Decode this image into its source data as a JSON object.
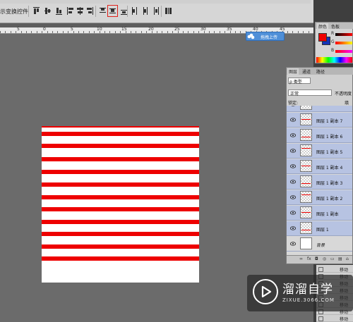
{
  "options_bar": {
    "label": "示变换控件",
    "tools": [
      {
        "name": "align-top-edges-icon"
      },
      {
        "name": "align-vertical-centers-icon"
      },
      {
        "name": "align-bottom-edges-icon"
      },
      {
        "name": "align-left-edges-icon"
      },
      {
        "name": "align-horizontal-centers-icon"
      },
      {
        "name": "align-right-edges-icon"
      },
      {
        "name": "distribute-top-edges-icon"
      },
      {
        "name": "distribute-vertical-centers-icon",
        "active": true
      },
      {
        "name": "distribute-bottom-edges-icon"
      },
      {
        "name": "distribute-left-edges-icon"
      },
      {
        "name": "distribute-horizontal-centers-icon"
      },
      {
        "name": "distribute-right-edges-icon"
      },
      {
        "name": "auto-align-layers-icon"
      }
    ],
    "active_outline_color": "#e0201a"
  },
  "ruler": {
    "labels": [
      "5",
      "0",
      "5",
      "10",
      "15",
      "20",
      "25",
      "30",
      "35",
      "40",
      "45"
    ]
  },
  "cloud_upload": {
    "label": "拖拽上传"
  },
  "color_panel": {
    "tabs": [
      "颜色",
      "色板"
    ],
    "foreground": "#ee0000",
    "background": "#1533b8",
    "channels": [
      "R",
      "G",
      "B"
    ]
  },
  "layers_panel": {
    "tabs": [
      "图层",
      "通道",
      "路径"
    ],
    "filter_label": "ρ 类型",
    "blend_mode": "正常",
    "opacity_label": "不透明度",
    "lock_label": "锁定:",
    "fill_label": "填充",
    "layers": [
      {
        "name": "",
        "selected": true,
        "partial": true
      },
      {
        "name": "图层 1 副本 7",
        "selected": true
      },
      {
        "name": "图层 1 副本 6",
        "selected": true
      },
      {
        "name": "图层 1 副本 5",
        "selected": true
      },
      {
        "name": "图层 1 副本 4",
        "selected": true
      },
      {
        "name": "图层 1 副本 3",
        "selected": true
      },
      {
        "name": "图层 1 副本 2",
        "selected": true
      },
      {
        "name": "图层 1 副本",
        "selected": true
      },
      {
        "name": "图层 1",
        "selected": true
      },
      {
        "name": "背景",
        "selected": false,
        "background": true
      }
    ],
    "bottom_icons": [
      "∞",
      "fx",
      "◘",
      "◎",
      "▭",
      "▤",
      "⌂"
    ]
  },
  "history_panel": {
    "items": [
      "移动",
      "移动",
      "移动",
      "移动",
      "移动",
      "移动",
      "移动",
      "移动"
    ]
  },
  "canvas": {
    "stripe_color": "#ee0000",
    "stripe_count": 12
  },
  "watermark": {
    "title": "溜溜自学",
    "url": "ZIXUE.3066.COM"
  }
}
